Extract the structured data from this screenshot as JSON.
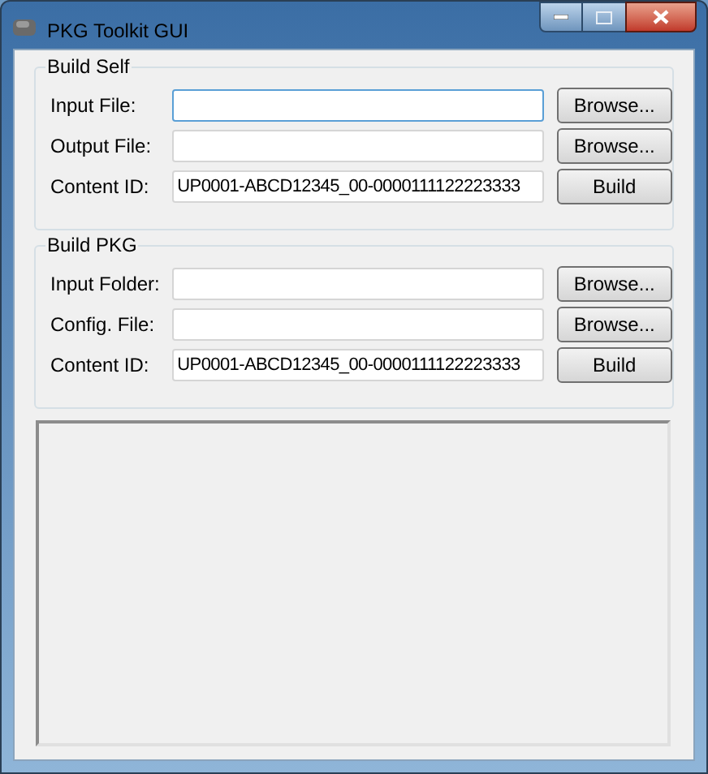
{
  "window": {
    "title": "PKG Toolkit GUI"
  },
  "groups": [
    {
      "title": "Build Self",
      "rows": [
        {
          "label": "Input File:",
          "value": "",
          "focused": true,
          "button": "Browse..."
        },
        {
          "label": "Output File:",
          "value": "",
          "focused": false,
          "button": "Browse..."
        },
        {
          "label": "Content ID:",
          "value": "UP0001-ABCD12345_00-0000111122223333",
          "focused": false,
          "button": "Build"
        }
      ]
    },
    {
      "title": "Build PKG",
      "rows": [
        {
          "label": "Input Folder:",
          "value": "",
          "focused": false,
          "button": "Browse..."
        },
        {
          "label": "Config. File:",
          "value": "",
          "focused": false,
          "button": "Browse..."
        },
        {
          "label": "Content ID:",
          "value": "UP0001-ABCD12345_00-0000111122223333",
          "focused": false,
          "button": "Build"
        }
      ]
    }
  ]
}
